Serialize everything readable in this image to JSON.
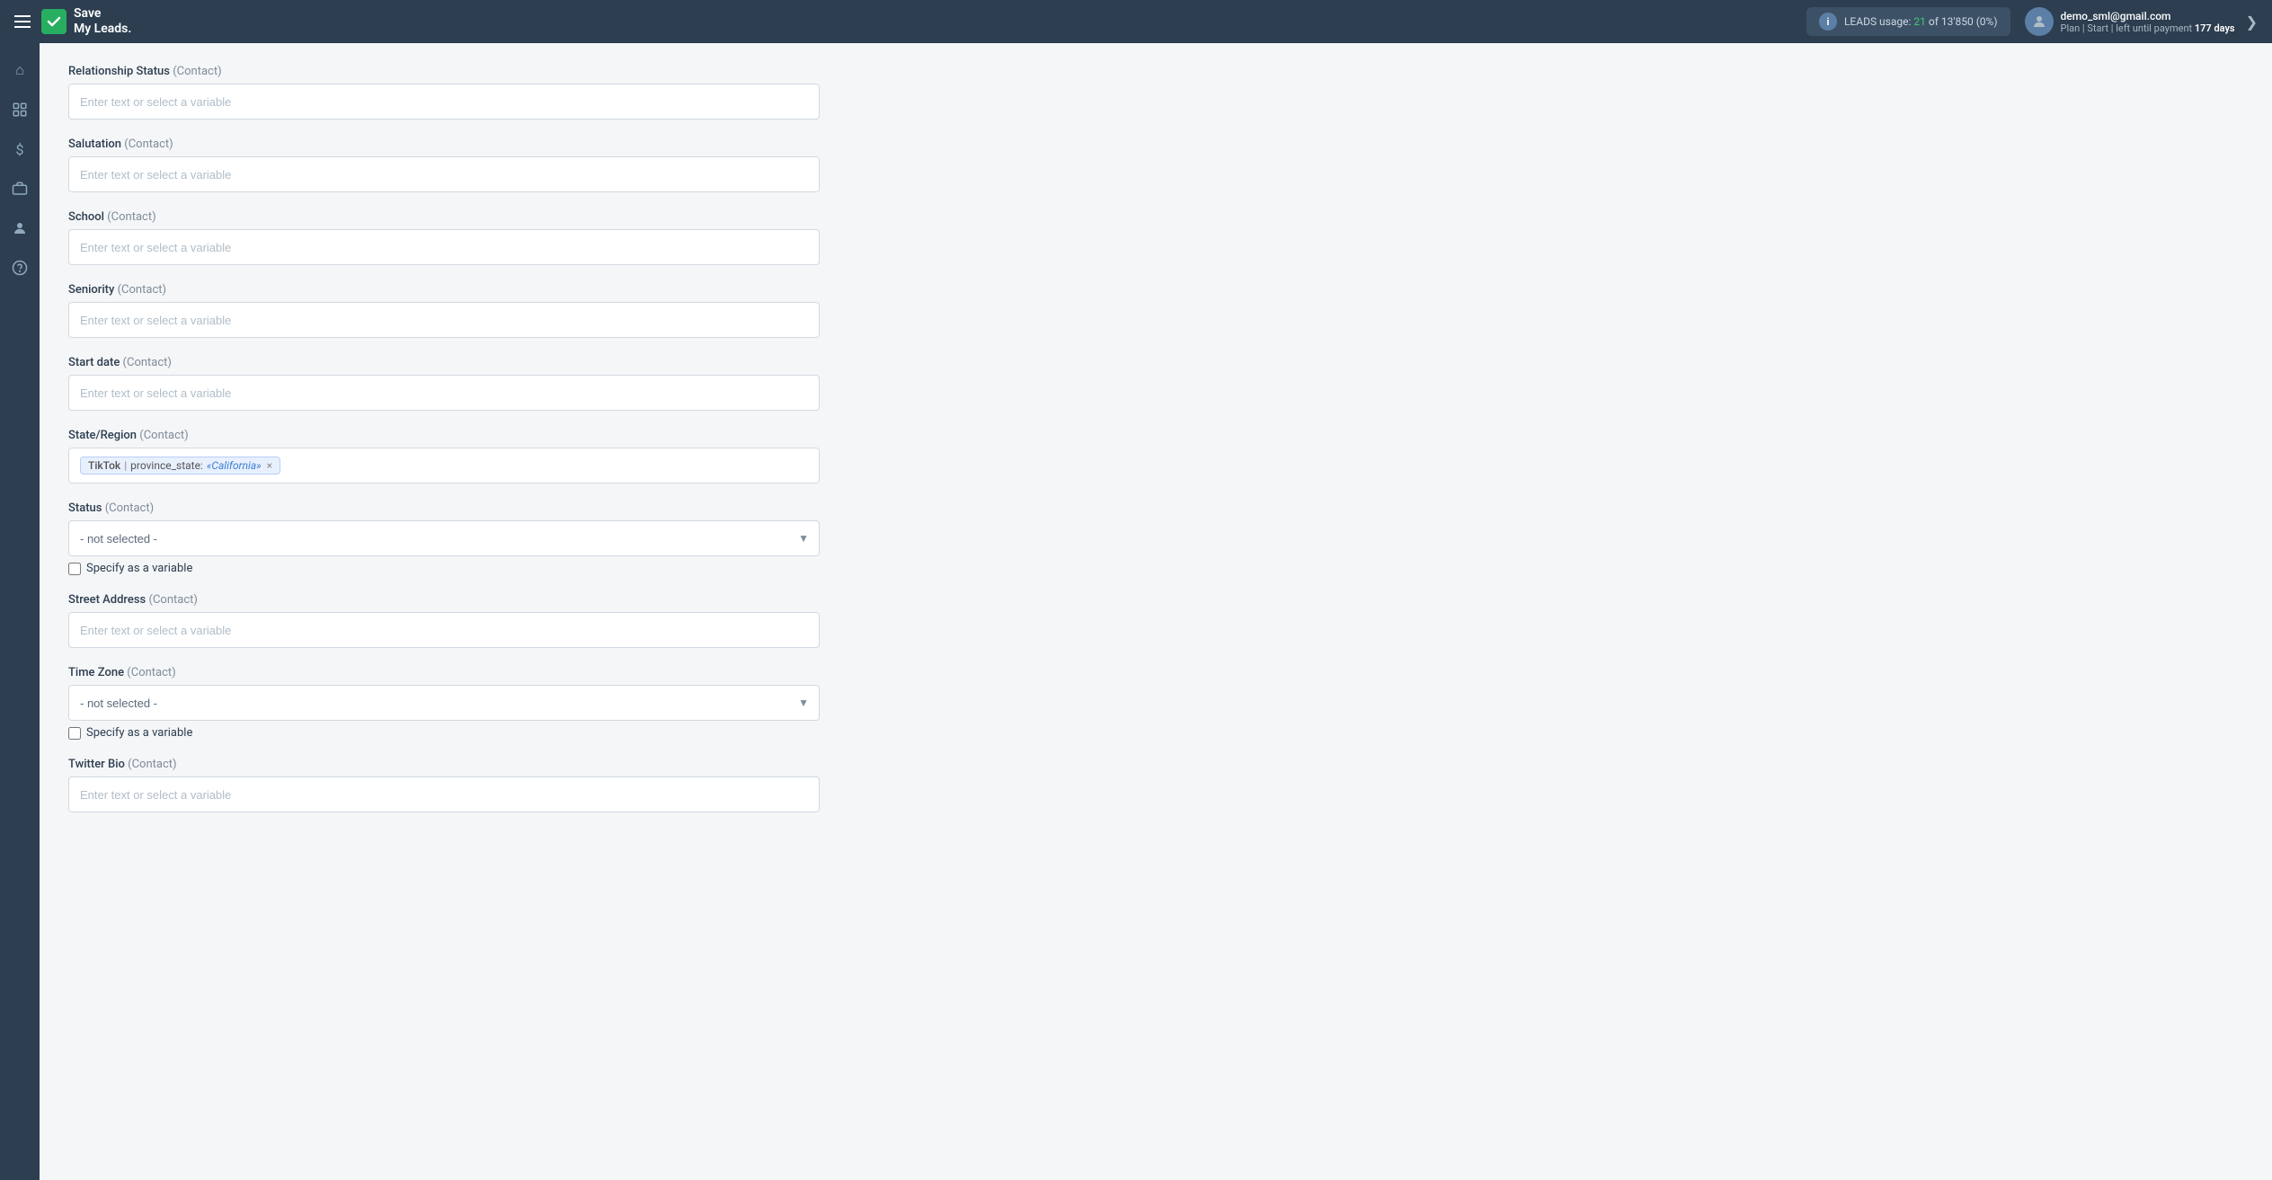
{
  "header": {
    "menu_icon": "≡",
    "logo_text_line1": "Save",
    "logo_text_line2": "My Leads.",
    "leads_label": "LEADS usage:",
    "leads_used": "21",
    "leads_of": "of",
    "leads_total": "13'850",
    "leads_percent": "(0%)",
    "user_email": "demo_sml@gmail.com",
    "user_plan_prefix": "Plan |",
    "user_plan_name": "Start",
    "user_plan_separator": "| left until payment",
    "user_plan_days_label": "177 days",
    "chevron": "❯"
  },
  "sidebar": {
    "items": [
      {
        "icon": "⌂",
        "name": "home-icon"
      },
      {
        "icon": "⊞",
        "name": "integrations-icon"
      },
      {
        "icon": "$",
        "name": "billing-icon"
      },
      {
        "icon": "✦",
        "name": "tools-icon"
      },
      {
        "icon": "👤",
        "name": "profile-icon"
      },
      {
        "icon": "?",
        "name": "help-icon"
      }
    ]
  },
  "form": {
    "fields": [
      {
        "id": "relationship-status",
        "label": "Relationship Status",
        "label_sub": "(Contact)",
        "type": "text",
        "placeholder": "Enter text or select a variable",
        "value": ""
      },
      {
        "id": "salutation",
        "label": "Salutation",
        "label_sub": "(Contact)",
        "type": "text",
        "placeholder": "Enter text or select a variable",
        "value": ""
      },
      {
        "id": "school",
        "label": "School",
        "label_sub": "(Contact)",
        "type": "text",
        "placeholder": "Enter text or select a variable",
        "value": ""
      },
      {
        "id": "seniority",
        "label": "Seniority",
        "label_sub": "(Contact)",
        "type": "text",
        "placeholder": "Enter text or select a variable",
        "value": ""
      },
      {
        "id": "start-date",
        "label": "Start date",
        "label_sub": "(Contact)",
        "type": "text",
        "placeholder": "Enter text or select a variable",
        "value": ""
      },
      {
        "id": "state-region",
        "label": "State/Region",
        "label_sub": "(Contact)",
        "type": "tag",
        "tag_source": "TikTok",
        "tag_separator": "|",
        "tag_field": "province_state:",
        "tag_value": "«California»"
      },
      {
        "id": "status",
        "label": "Status",
        "label_sub": "(Contact)",
        "type": "select",
        "value": "- not selected -",
        "options": [
          "- not selected -"
        ],
        "specify_variable": true,
        "specify_variable_label": "Specify as a variable"
      },
      {
        "id": "street-address",
        "label": "Street Address",
        "label_sub": "(Contact)",
        "type": "text",
        "placeholder": "Enter text or select a variable",
        "value": ""
      },
      {
        "id": "time-zone",
        "label": "Time Zone",
        "label_sub": "(Contact)",
        "type": "select",
        "value": "- not selected -",
        "options": [
          "- not selected -"
        ],
        "specify_variable": true,
        "specify_variable_label": "Specify as a variable"
      },
      {
        "id": "twitter-bio",
        "label": "Twitter Bio",
        "label_sub": "(Contact)",
        "type": "text",
        "placeholder": "Enter text or select a variable",
        "value": ""
      }
    ]
  }
}
